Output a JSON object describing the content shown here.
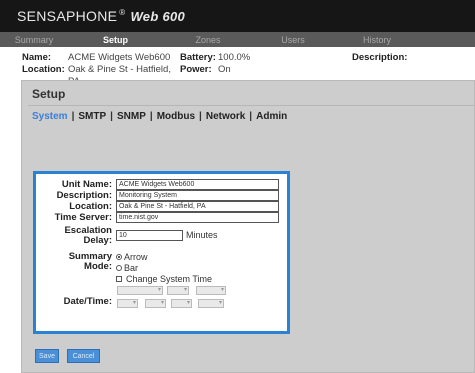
{
  "header": {
    "brand": "SENSAPHONE",
    "reg": "®",
    "model": "Web 600"
  },
  "nav": {
    "tabs": [
      {
        "label": "Summary",
        "active": false
      },
      {
        "label": "Setup",
        "active": true
      },
      {
        "label": "Zones",
        "active": false
      },
      {
        "label": "Users",
        "active": false
      },
      {
        "label": "History",
        "active": false
      }
    ]
  },
  "device_info": {
    "name_label": "Name:",
    "name_value": "ACME Widgets Web600",
    "location_label": "Location:",
    "location_value": "Oak & Pine St - Hatfield, PA",
    "battery_label": "Battery:",
    "battery_value": "100.0%",
    "power_label": "Power:",
    "power_value": "On",
    "description_label": "Description:"
  },
  "panel": {
    "title": "Setup"
  },
  "subtabs": [
    "System",
    "SMTP",
    "SNMP",
    "Modbus",
    "Network",
    "Admin"
  ],
  "form": {
    "unit_name_label": "Unit Name:",
    "unit_name_value": "ACME Widgets Web600",
    "description_label": "Description:",
    "description_value": "Monitoring System",
    "location_label": "Location:",
    "location_value": "Oak & Pine St - Hatfield, PA",
    "time_server_label": "Time Server:",
    "time_server_value": "time.nist.gov",
    "escalation_label": "Escalation\nDelay:",
    "escalation_value": "10",
    "escalation_unit": "Minutes",
    "summary_mode_label": "Summary\nMode:",
    "mode_arrow": "Arrow",
    "mode_bar": "Bar",
    "change_time_label": "Change System Time",
    "datetime_label": "Date/Time:"
  },
  "buttons": {
    "save": "Save",
    "cancel": "Cancel"
  }
}
